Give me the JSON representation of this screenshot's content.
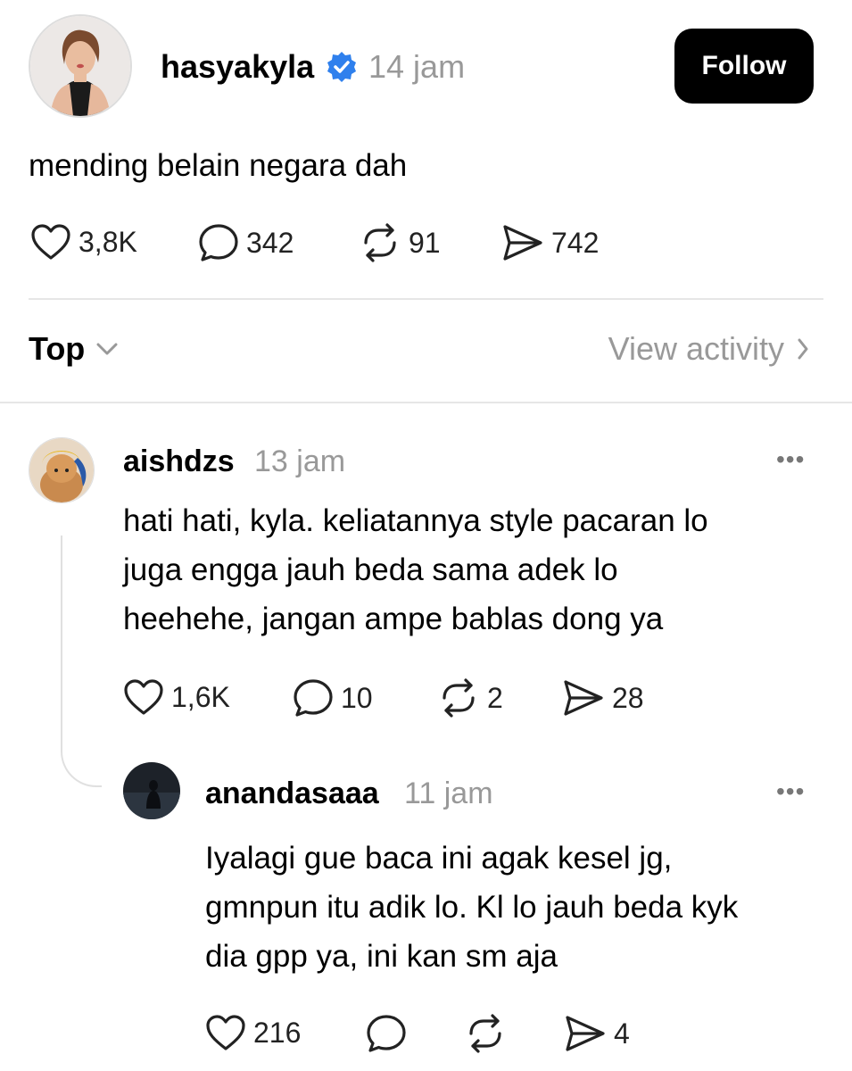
{
  "post": {
    "username": "hasyakyla",
    "time": "14 jam",
    "follow_label": "Follow",
    "text": "mending belain negara dah",
    "likes": "3,8K",
    "replies": "342",
    "reposts": "91",
    "shares": "742",
    "verified_color": "#2f80ed"
  },
  "sort_bar": {
    "sort_label": "Top",
    "activity_label": "View activity"
  },
  "comments": [
    {
      "username": "aishdzs",
      "time": "13 jam",
      "lines": [
        "hati hati, kyla. keliatannya style pacaran lo",
        "juga engga jauh beda sama adek lo",
        "heehehe, jangan ampe bablas dong ya"
      ],
      "likes": "1,6K",
      "replies": "10",
      "reposts": "2",
      "shares": "28"
    },
    {
      "username": "anandasaaa",
      "time": "11 jam",
      "lines": [
        "Iyalagi gue baca ini agak kesel jg,",
        "gmnpun itu adik lo. Kl lo jauh beda kyk",
        "dia gpp ya, ini kan sm aja"
      ],
      "likes": "216",
      "shares": "4"
    }
  ]
}
